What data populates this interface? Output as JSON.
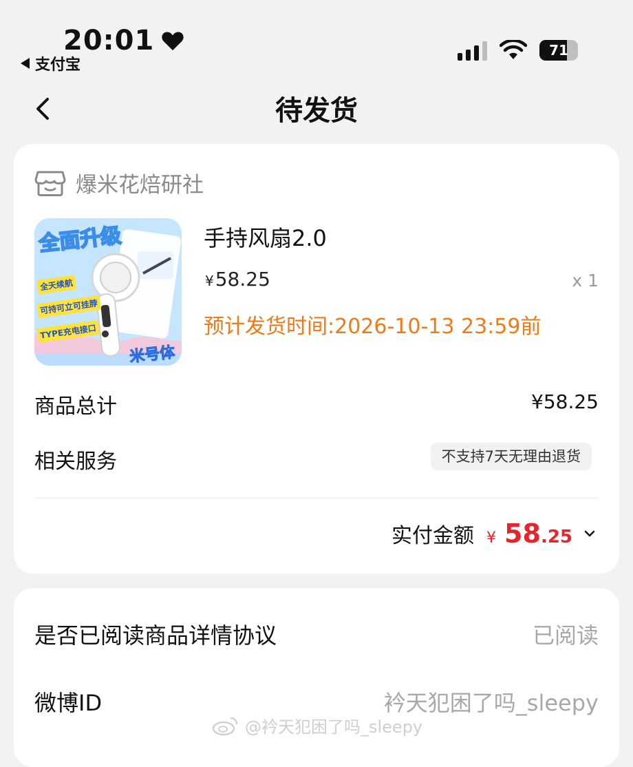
{
  "status_bar": {
    "time": "20:01",
    "back_app": "支付宝",
    "battery": "71",
    "battery_level": 0.71
  },
  "nav": {
    "title": "待发货"
  },
  "order": {
    "shop_name": "爆米花焙研社",
    "product": {
      "title": "手持风扇2.0",
      "currency": "¥",
      "price": "58.25",
      "quantity": "x 1",
      "ship_time": "预计发货时间:2026-10-13 23:59前",
      "image_texts": [
        "全面升级",
        "全天续航",
        "可持可立可挂脖",
        "TYPE充电接口",
        "米号体"
      ]
    },
    "subtotal_label": "商品总计",
    "subtotal_value": "¥58.25",
    "service_label": "相关服务",
    "service_tag": "不支持7天无理由退货",
    "paid_label": "实付金额",
    "paid_currency": "¥",
    "paid_integer": "58",
    "paid_decimal": ".25"
  },
  "info": {
    "agreement_label": "是否已阅读商品详情协议",
    "agreement_value": "已阅读",
    "weibo_label": "微博ID",
    "weibo_value": "衿天犯困了吗_sleepy"
  },
  "watermark": {
    "text": "@衿天犯困了吗_sleepy"
  },
  "colors": {
    "accent_orange": "#f07a18",
    "price_red": "#e6242c",
    "background": "#f2f2f2"
  }
}
